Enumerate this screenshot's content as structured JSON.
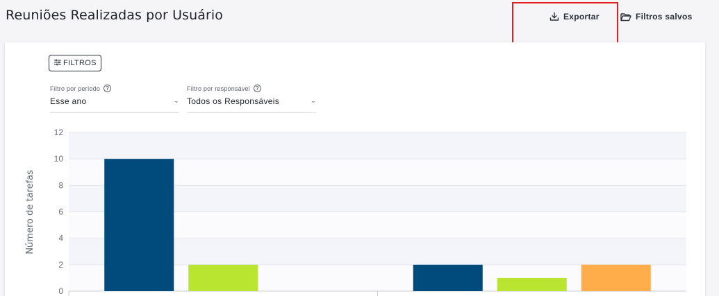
{
  "header": {
    "title": "Reuniões Realizadas por Usuário",
    "export_label": "Exportar",
    "saved_filters_label": "Filtros salvos"
  },
  "filters": {
    "button_label": "FILTROS",
    "period": {
      "label": "Filtro por período",
      "value": "Esse ano"
    },
    "responsible": {
      "label": "Filtro por responsável",
      "value": "Todos os Responsáveis"
    }
  },
  "colors": {
    "series_1": "#004a7c",
    "series_2": "#b9e530",
    "series_3": "#ffad4a",
    "highlight": "#e51f1f"
  },
  "chart_data": {
    "type": "bar",
    "ylabel": "Número de tarefas",
    "ylim": [
      0,
      12
    ],
    "yticks": [
      0,
      2,
      4,
      6,
      8,
      10,
      12
    ],
    "categories": [
      "",
      ""
    ],
    "series": [
      {
        "values": [
          10,
          2
        ]
      },
      {
        "values": [
          2,
          1
        ]
      },
      {
        "values": [
          0,
          2
        ]
      }
    ],
    "grid": true
  }
}
